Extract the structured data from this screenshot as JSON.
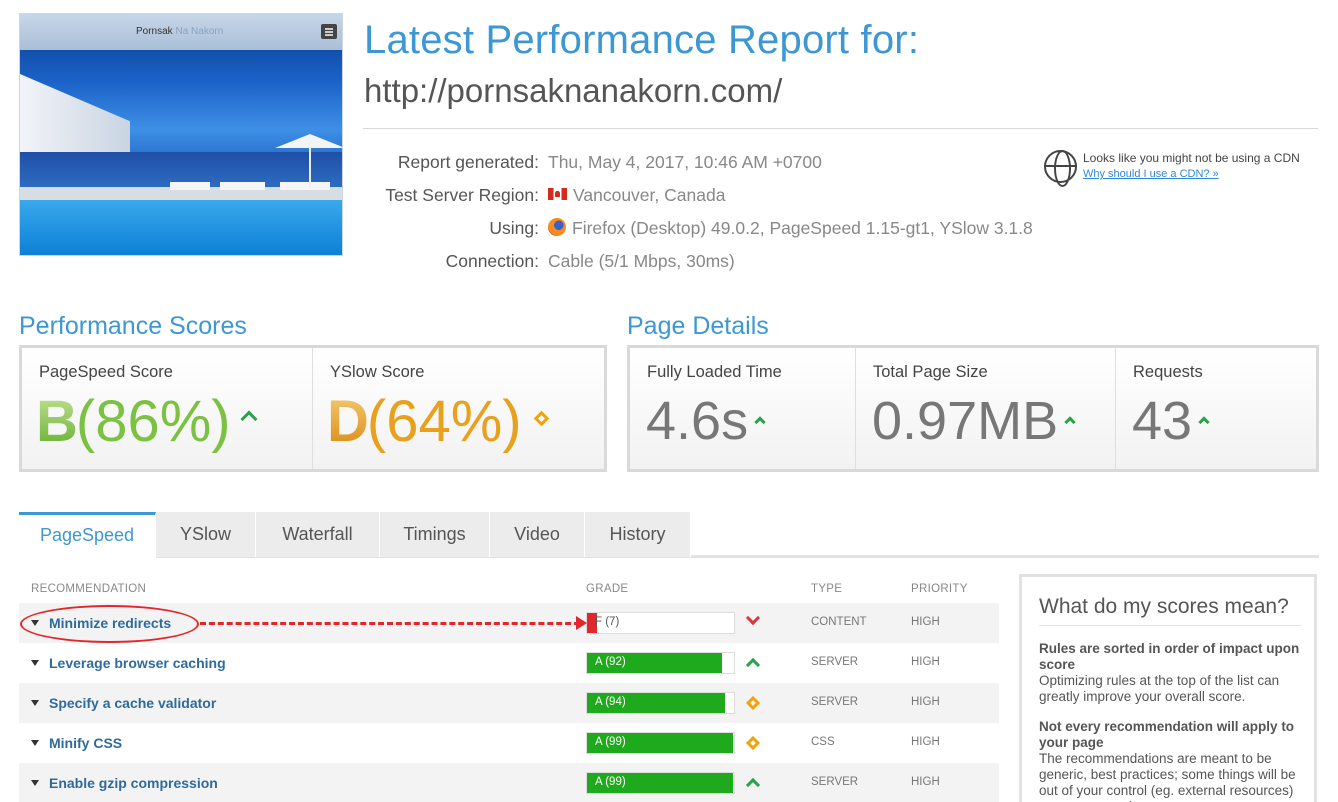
{
  "thumbnail": {
    "brand_dark": "Pornsak",
    "brand_light": "Na Nakorn"
  },
  "header": {
    "title": "Latest Performance Report for:",
    "url": "http://pornsaknanakorn.com/"
  },
  "meta": {
    "report_generated_label": "Report generated:",
    "report_generated_value": "Thu, May 4, 2017, 10:46 AM +0700",
    "region_label": "Test Server Region:",
    "region_value": "Vancouver, Canada",
    "using_label": "Using:",
    "using_value": "Firefox (Desktop) 49.0.2, PageSpeed 1.15-gt1, YSlow 3.1.8",
    "connection_label": "Connection:",
    "connection_value": "Cable (5/1 Mbps, 30ms)"
  },
  "cdn": {
    "notice": "Looks like you might not be using a CDN",
    "link": "Why should I use a CDN? »"
  },
  "performance": {
    "title": "Performance Scores",
    "pagespeed_label": "PageSpeed Score",
    "pagespeed_grade": "B",
    "pagespeed_pct": "(86%)",
    "yslow_label": "YSlow Score",
    "yslow_grade": "D",
    "yslow_pct": "(64%)"
  },
  "details": {
    "title": "Page Details",
    "loaded_label": "Fully Loaded Time",
    "loaded_value": "4.6s",
    "size_label": "Total Page Size",
    "size_value": "0.97MB",
    "requests_label": "Requests",
    "requests_value": "43"
  },
  "tabs": [
    "PageSpeed",
    "YSlow",
    "Waterfall",
    "Timings",
    "Video",
    "History"
  ],
  "table": {
    "headers": {
      "recommendation": "RECOMMENDATION",
      "grade": "GRADE",
      "type": "TYPE",
      "priority": "PRIORITY"
    },
    "rows": [
      {
        "name": "Minimize redirects",
        "grade": "F (7)",
        "score": 7,
        "trend": "down",
        "type": "CONTENT",
        "priority": "HIGH"
      },
      {
        "name": "Leverage browser caching",
        "grade": "A (92)",
        "score": 92,
        "trend": "up",
        "type": "SERVER",
        "priority": "HIGH"
      },
      {
        "name": "Specify a cache validator",
        "grade": "A (94)",
        "score": 94,
        "trend": "same",
        "type": "SERVER",
        "priority": "HIGH"
      },
      {
        "name": "Minify CSS",
        "grade": "A (99)",
        "score": 99,
        "trend": "same",
        "type": "CSS",
        "priority": "HIGH"
      },
      {
        "name": "Enable gzip compression",
        "grade": "A (99)",
        "score": 99,
        "trend": "up",
        "type": "SERVER",
        "priority": "HIGH"
      }
    ]
  },
  "side_panel": {
    "title": "What do my scores mean?",
    "h1": "Rules are sorted in order of impact upon score",
    "p1": "Optimizing rules at the top of the list can greatly improve your overall score.",
    "h2": "Not every recommendation will apply to your page",
    "p2": "The recommendations are meant to be generic, best practices; some things will be out of your control (eg. external resources) or may not apply to your"
  },
  "colors": {
    "accent": "#3d97d3",
    "grade_b": "#7cc242",
    "grade_d": "#e8a01d",
    "bar_good": "#1fa91c",
    "bar_bad": "#e0272b",
    "annotation": "#e2262c"
  }
}
